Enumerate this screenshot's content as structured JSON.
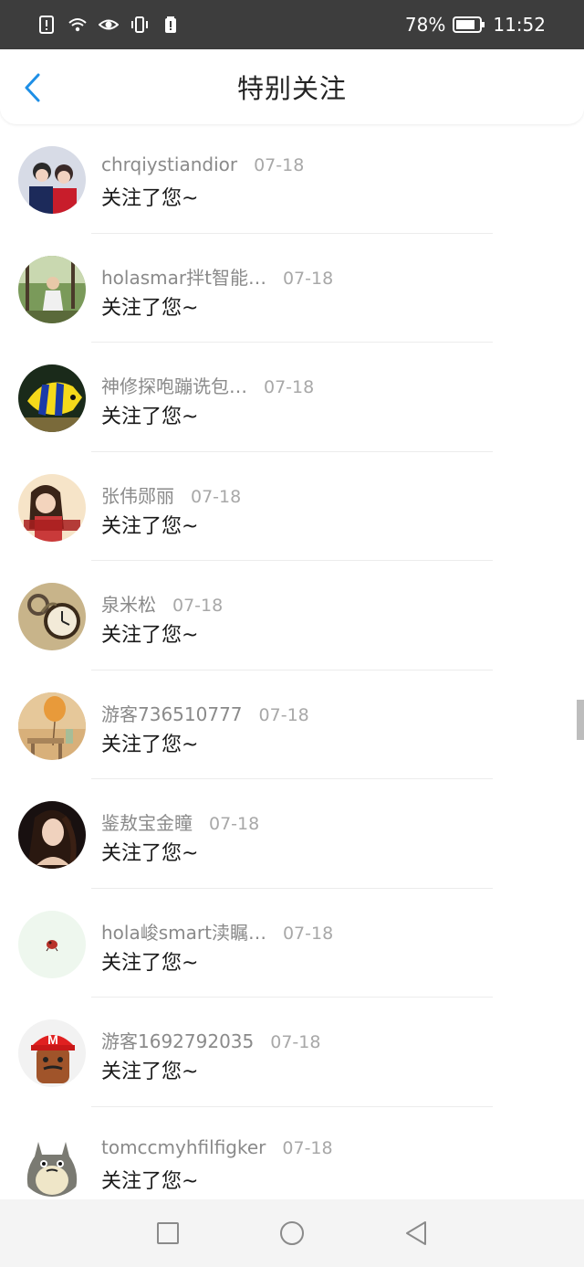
{
  "status_bar": {
    "battery_percent": "78%",
    "time": "11:52",
    "icons": [
      "sim-alert-icon",
      "wifi-icon",
      "eye-icon",
      "vibrate-icon",
      "small-battery-icon",
      "battery-icon"
    ]
  },
  "header": {
    "title": "特别关注",
    "back_icon": "chevron-left-icon",
    "accent_color": "#1e8fe6"
  },
  "notifications": [
    {
      "name": "chrqiystiandior",
      "time": "07-18",
      "message": "关注了您~",
      "avatar": "two-girls-photo"
    },
    {
      "name": "holasmar拌t智能…",
      "time": "07-18",
      "message": "关注了您~",
      "avatar": "girl-in-forest-photo"
    },
    {
      "name": "神修探咆蹦诜包…",
      "time": "07-18",
      "message": "关注了您~",
      "avatar": "tropical-fish-photo"
    },
    {
      "name": "张伟郧丽",
      "time": "07-18",
      "message": "关注了您~",
      "avatar": "girl-portrait-photo"
    },
    {
      "name": "泉米松",
      "time": "07-18",
      "message": "关注了您~",
      "avatar": "pocket-watch-photo"
    },
    {
      "name": "游客736510777",
      "time": "07-18",
      "message": "关注了您~",
      "avatar": "balloon-room-photo"
    },
    {
      "name": "鉴敖宝金瞳",
      "time": "07-18",
      "message": "关注了您~",
      "avatar": "dark-hair-girl-photo"
    },
    {
      "name": "hola峻smart渎瞩…",
      "time": "07-18",
      "message": "关注了您~",
      "avatar": "small-red-bug-photo"
    },
    {
      "name": "游客1692792035",
      "time": "07-18",
      "message": "关注了您~",
      "avatar": "red-cap-character-photo"
    },
    {
      "name": "tomccmyhfilfigker",
      "time": "07-18",
      "message": "关注了您~",
      "avatar": "totoro-cartoon"
    }
  ],
  "bottom_nav": {
    "icons": [
      "recent-apps-square-icon",
      "home-circle-icon",
      "back-triangle-icon"
    ]
  }
}
